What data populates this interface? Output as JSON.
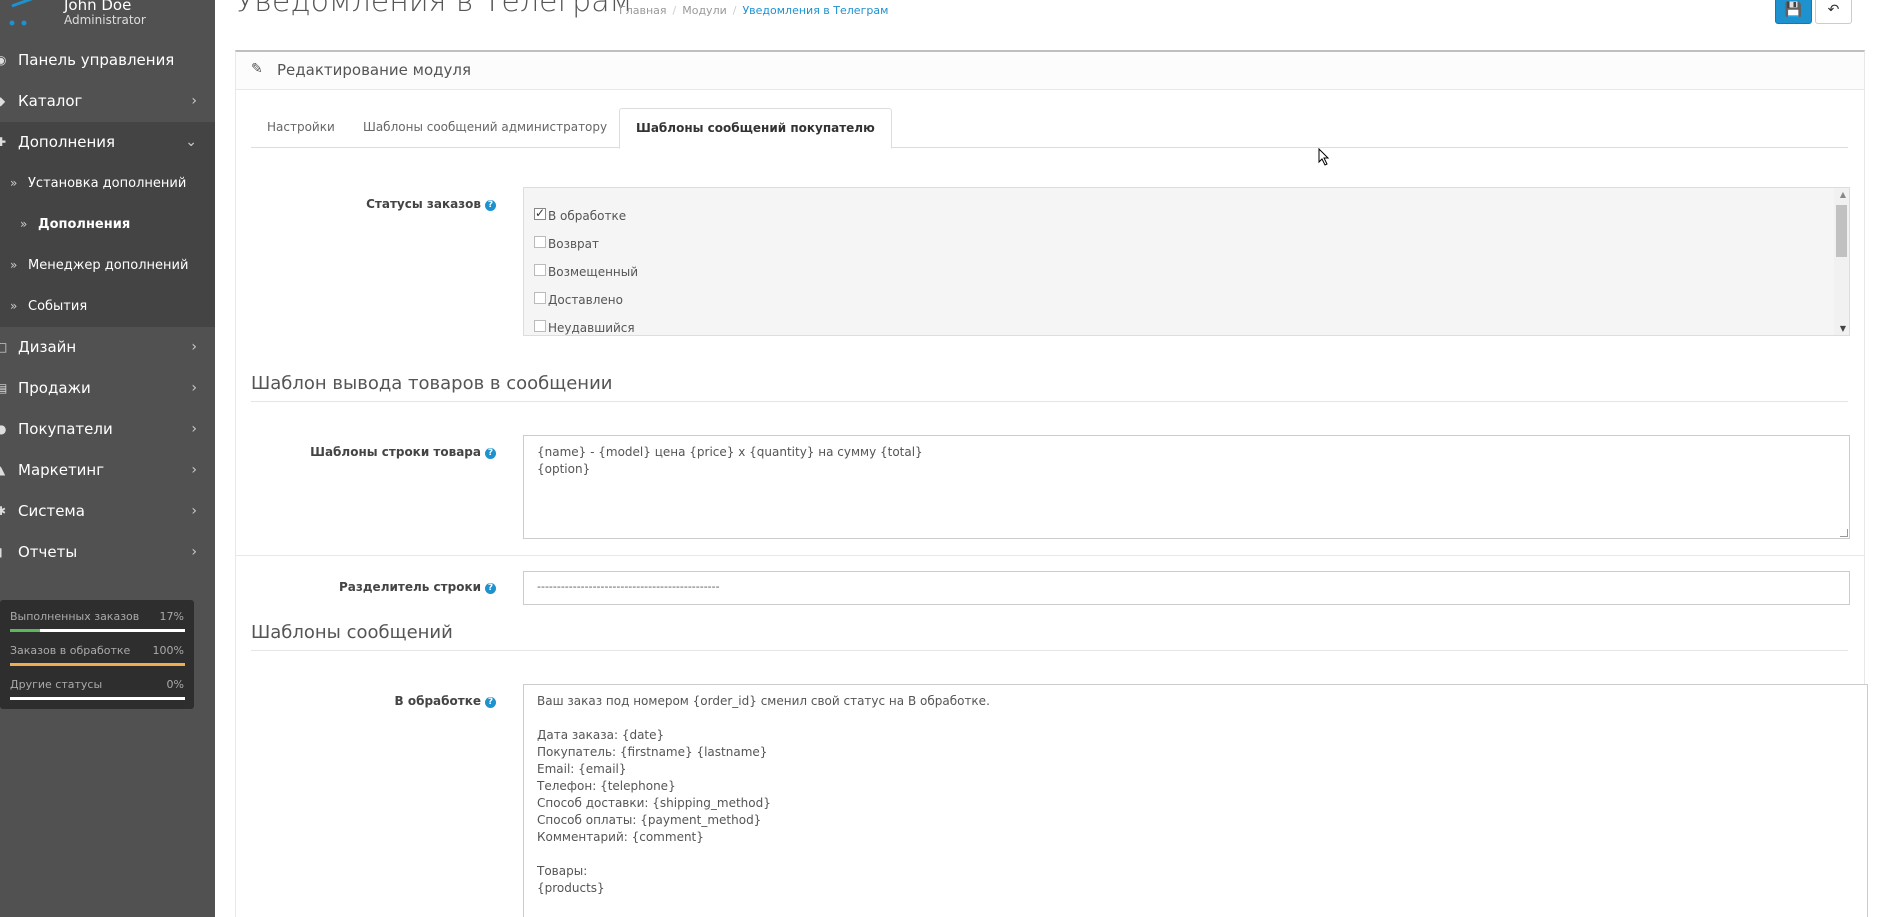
{
  "profile": {
    "name": "John Doe",
    "role": "Administrator"
  },
  "sidebar": {
    "items": [
      {
        "label": "Панель управления",
        "icon": "dashboard-icon",
        "has_children": false
      },
      {
        "label": "Каталог",
        "icon": "tag-icon",
        "has_children": true
      },
      {
        "label": "Дополнения",
        "icon": "puzzle-icon",
        "has_children": true,
        "expanded": true
      },
      {
        "label": "Дизайн",
        "icon": "monitor-icon",
        "has_children": true
      },
      {
        "label": "Продажи",
        "icon": "cart-icon",
        "has_children": true
      },
      {
        "label": "Покупатели",
        "icon": "user-icon",
        "has_children": true
      },
      {
        "label": "Маркетинг",
        "icon": "share-icon",
        "has_children": true
      },
      {
        "label": "Система",
        "icon": "gear-icon",
        "has_children": true
      },
      {
        "label": "Отчеты",
        "icon": "bar-chart-icon",
        "has_children": true
      }
    ],
    "subitems": [
      {
        "label": "Установка дополнений"
      },
      {
        "label": "Дополнения",
        "current": true
      },
      {
        "label": "Менеджер дополнений"
      },
      {
        "label": "События"
      }
    ]
  },
  "stats": [
    {
      "label": "Выполненных заказов",
      "value": "17%",
      "percent": 17,
      "color": "#5cb85c"
    },
    {
      "label": "Заказов в обработке",
      "value": "100%",
      "percent": 100,
      "color": "#f0ad4e"
    },
    {
      "label": "Другие статусы",
      "value": "0%",
      "percent": 0,
      "color": "#d9534f"
    }
  ],
  "header": {
    "title": "Уведомления в Телеграм",
    "breadcrumb": [
      "Главная",
      "Модули",
      "Уведомления в Телеграм"
    ]
  },
  "panel": {
    "heading": "Редактирование модуля"
  },
  "tabs": [
    {
      "label": "Настройки"
    },
    {
      "label": "Шаблоны сообщений администратору"
    },
    {
      "label": "Шаблоны сообщений покупателю",
      "active": true
    }
  ],
  "form": {
    "statuses_label": "Статусы заказов",
    "statuses": [
      {
        "label": "В обработке",
        "checked": true
      },
      {
        "label": "Возврат",
        "checked": false
      },
      {
        "label": "Возмещенный",
        "checked": false
      },
      {
        "label": "Доставлено",
        "checked": false
      },
      {
        "label": "Неудавшийся",
        "checked": false
      }
    ],
    "products_section_title": "Шаблон вывода товаров в сообщении",
    "product_line_label": "Шаблоны строки товара",
    "product_line_value": "{name} - {model} цена {price} x {quantity} на сумму {total}\n{option}",
    "separator_label": "Разделитель строки",
    "separator_value": "----------------------------------------------",
    "messages_section_title": "Шаблоны сообщений",
    "processing_label": "В обработке",
    "processing_value": "Ваш заказ под номером {order_id} сменил свой статус на В обработке.\n\nДата заказа: {date}\nПокупатель: {firstname} {lastname}\nEmail: {email}\nТелефон: {telephone}\nСпособ доставки: {shipping_method}\nСпособ оплаты: {payment_method}\nКомментарий: {comment}\n\nТовары:\n{products}"
  },
  "colors": {
    "accent": "#1e91cf",
    "sidebar_bg": "#515151",
    "sidebar_active": "#444444"
  }
}
